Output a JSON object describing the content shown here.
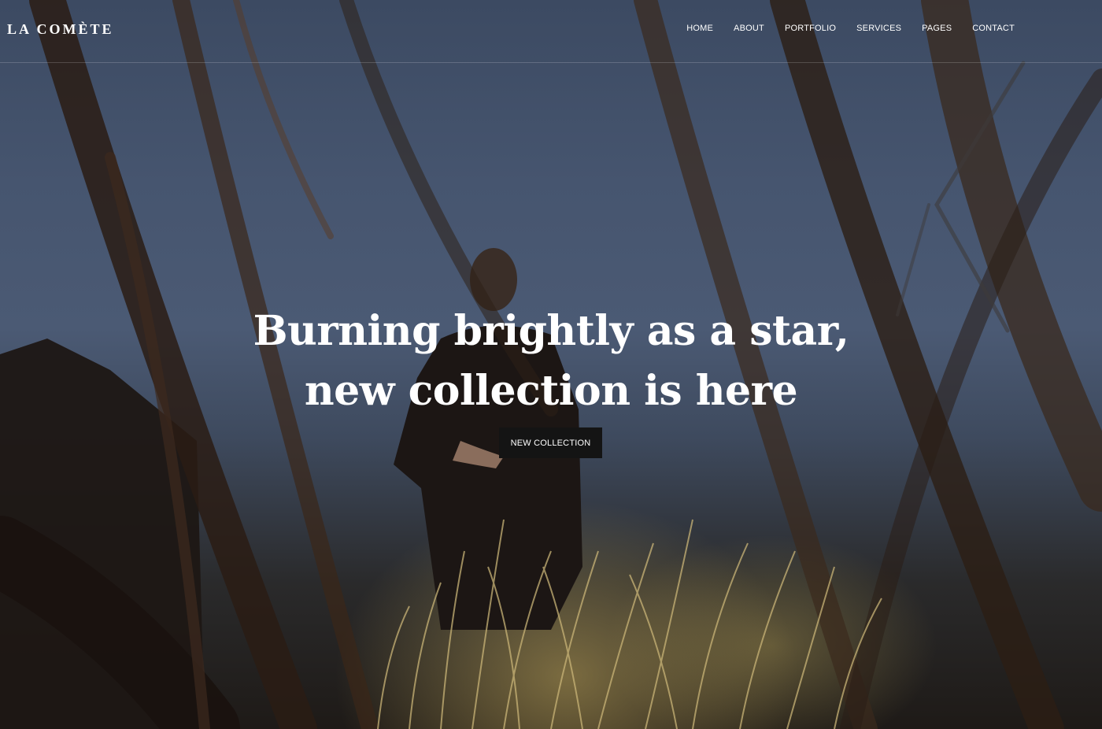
{
  "site": {
    "logo": "LA COMÈTE"
  },
  "nav": {
    "items": [
      {
        "label": "HOME"
      },
      {
        "label": "ABOUT"
      },
      {
        "label": "PORTFOLIO"
      },
      {
        "label": "SERVICES"
      },
      {
        "label": "PAGES"
      },
      {
        "label": "CONTACT"
      }
    ]
  },
  "hero": {
    "headline_line1": "Burning brightly as a star,",
    "headline_line2": "new collection is here",
    "cta_label": "NEW COLLECTION"
  },
  "colors": {
    "sky": "#46556f",
    "button": "#141414",
    "text": "#ffffff"
  }
}
